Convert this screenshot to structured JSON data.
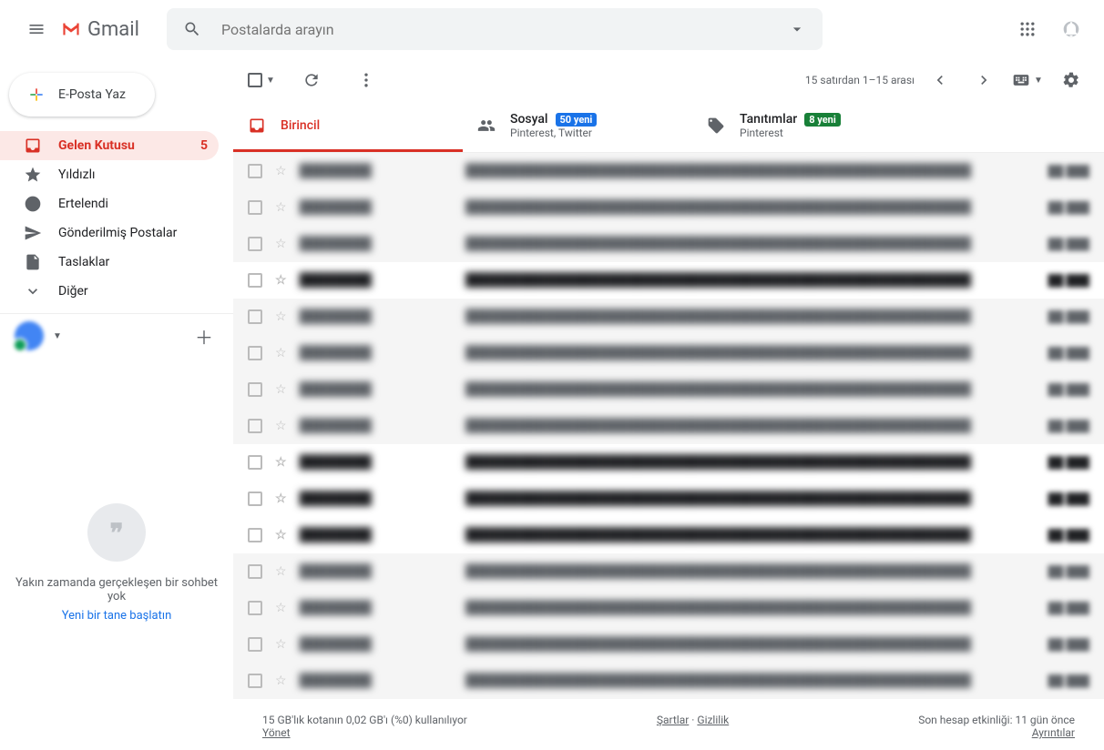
{
  "header": {
    "app_name": "Gmail",
    "search_placeholder": "Postalarda arayın"
  },
  "compose_label": "E-Posta Yaz",
  "sidebar": {
    "items": [
      {
        "label": "Gelen Kutusu",
        "count": "5",
        "active": true,
        "icon": "inbox"
      },
      {
        "label": "Yıldızlı",
        "icon": "star"
      },
      {
        "label": "Ertelendi",
        "icon": "clock"
      },
      {
        "label": "Gönderilmiş Postalar",
        "icon": "send"
      },
      {
        "label": "Taslaklar",
        "icon": "draft"
      },
      {
        "label": "Diğer",
        "icon": "more"
      }
    ]
  },
  "hangouts": {
    "empty_text": "Yakın zamanda gerçekleşen bir sohbet yok",
    "start_new": "Yeni bir tane başlatın"
  },
  "toolbar": {
    "range": "15 satırdan 1–15 arası"
  },
  "tabs": [
    {
      "title": "Birincil",
      "sub": "",
      "badge": "",
      "active": true
    },
    {
      "title": "Sosyal",
      "sub": "Pinterest, Twitter",
      "badge": "50 yeni",
      "badge_class": "blue"
    },
    {
      "title": "Tanıtımlar",
      "sub": "Pinterest",
      "badge": "8 yeni",
      "badge_class": "green"
    }
  ],
  "mails": [
    {
      "read": true
    },
    {
      "read": true
    },
    {
      "read": true
    },
    {
      "read": false
    },
    {
      "read": true
    },
    {
      "read": true
    },
    {
      "read": true
    },
    {
      "read": true
    },
    {
      "read": false
    },
    {
      "read": false
    },
    {
      "read": false
    },
    {
      "read": true
    },
    {
      "read": true
    },
    {
      "read": true
    },
    {
      "read": true
    }
  ],
  "footer": {
    "storage": "15 GB'lık kotanın 0,02 GB'ı (%0) kullanılıyor",
    "manage": "Yönet",
    "terms": "Şartlar",
    "privacy": "Gizlilik",
    "activity": "Son hesap etkinliği: 11 gün önce",
    "details": "Ayrıntılar"
  }
}
